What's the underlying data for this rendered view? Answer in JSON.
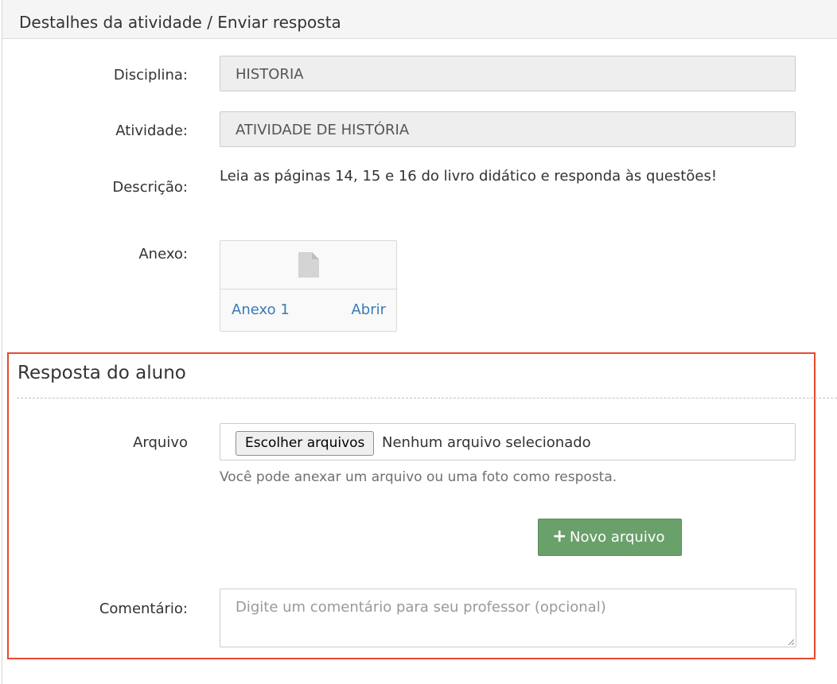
{
  "panel": {
    "title": "Destalhes da atividade / Enviar resposta"
  },
  "details": {
    "discipline_label": "Disciplina:",
    "discipline_value": "HISTORIA",
    "activity_label": "Atividade:",
    "activity_value": "ATIVIDADE DE HISTÓRIA",
    "description_label": "Descrição:",
    "description_value": "Leia as páginas 14, 15 e 16 do livro didático e responda às questões!",
    "attachment_label": "Anexo:",
    "attachment": {
      "icon": "file-icon",
      "name": "Anexo 1",
      "open_label": "Abrir"
    }
  },
  "response": {
    "section_title": "Resposta do aluno",
    "file_label": "Arquivo",
    "choose_button": "Escolher arquivos",
    "no_file_text": "Nenhum arquivo selecionado",
    "help_text": "Você pode anexar um arquivo ou uma foto como resposta.",
    "new_file_button": "Novo arquivo",
    "new_file_icon": "plus-icon",
    "comment_label": "Comentário:",
    "comment_placeholder": "Digite um comentário para seu professor (opcional)"
  },
  "colors": {
    "highlight_border": "#e8492f",
    "link": "#3a7ab8",
    "success_button": "#6aa06a"
  }
}
